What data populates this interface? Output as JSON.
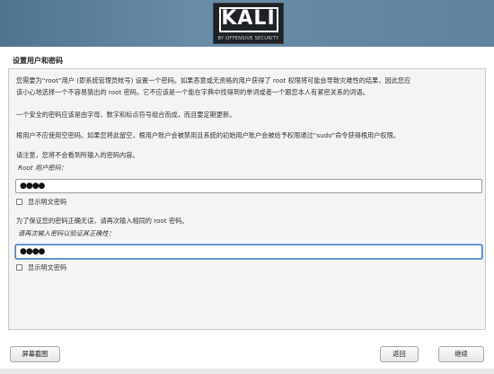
{
  "banner": {
    "logo_text": "KALI",
    "logo_subtitle": "BY OFFENSIVE SECURITY"
  },
  "page_title": "设置用户和密码",
  "paragraphs": {
    "intro_1": "您需要为“root”用户 (即系统管理员帐号) 设置一个密码。如果恶意或无资格的用户获得了 root 权限将可能会导致灾难性的结果，因此您应",
    "intro_2": "该小心地选择一个不容易猜出的 root 密码。它不应该是一个能在字典中找得到的单词或者一个跟您本人有紧密关系的词语。",
    "rule": "一个安全的密码应该是由字母、数字和标点符号组合而成，而且要定期更新。",
    "empty_note": "根用户不应使用空密码。如果您将此留空，根用户账户会被禁用且系统的初始用户账户会被给予权限通过“sudo”命令获得根用户权限。",
    "notice": "请注意，您将不会看到所输入的密码内容。",
    "confirm_note": "为了保证您的密码正确无误，请再次输入相同的 root 密码。"
  },
  "fields": {
    "root_label": "Root 用户密码：",
    "root_value": "●●●●",
    "confirm_label": "请再次输入密码以验证其正确性：",
    "confirm_value": "●●●●"
  },
  "checkbox": {
    "show_plain_1": "显示明文密码",
    "show_plain_2": "显示明文密码"
  },
  "buttons": {
    "screenshot": "屏幕截图",
    "back": "返回",
    "continue": "继续"
  }
}
